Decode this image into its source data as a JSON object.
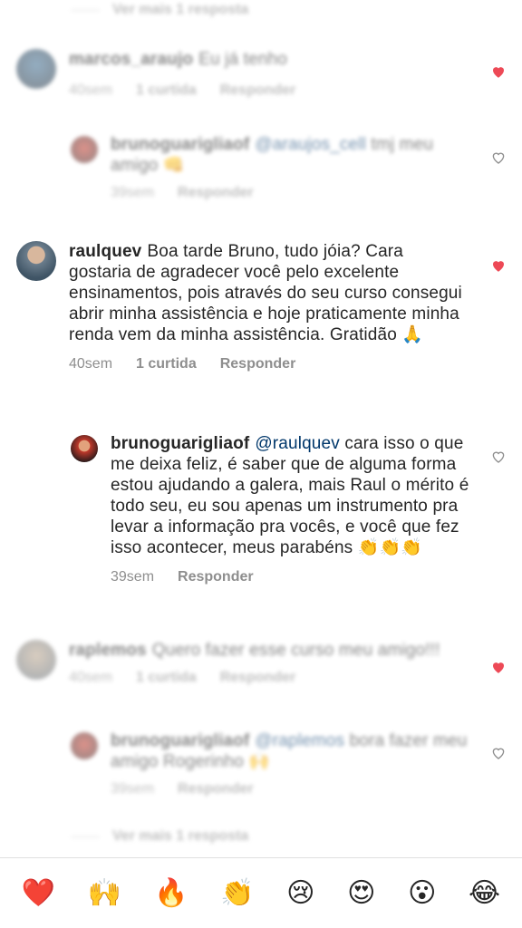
{
  "view_more_top": "Ver mais 1 resposta",
  "view_more_bottom": "Ver mais 1 resposta",
  "comments": {
    "c1": {
      "user": "marcos_araujo",
      "text": "Eu já tenho",
      "time": "40sem",
      "likes": "1 curtida",
      "reply": "Responder"
    },
    "c1r": {
      "user": "brunoguarigliaof",
      "mention": "@araujos_cell",
      "text": "tmj meu amigo 👊",
      "time": "39sem",
      "reply": "Responder"
    },
    "c2": {
      "user": "raulquev",
      "text": "Boa tarde Bruno, tudo jóia? Cara gostaria de agradecer você pelo excelente ensinamentos, pois através do seu curso consegui abrir minha assistência e hoje praticamente minha renda vem da minha assistência. Gratidão 🙏",
      "time": "40sem",
      "likes": "1 curtida",
      "reply": "Responder"
    },
    "c2r": {
      "user": "brunoguarigliaof",
      "mention": "@raulquev",
      "text": "cara isso o que me deixa feliz, é saber que de alguma forma estou ajudando a galera, mais Raul o mérito é todo seu, eu sou apenas um instrumento pra levar a informação pra vocês, e você que fez isso acontecer, meus parabéns 👏👏👏",
      "time": "39sem",
      "reply": "Responder"
    },
    "c3": {
      "user": "raplemos",
      "text": "Quero fazer esse curso meu amigo!!!",
      "time": "40sem",
      "likes": "1 curtida",
      "reply": "Responder"
    },
    "c3r": {
      "user": "brunoguarigliaof",
      "mention": "@raplemos",
      "text": "bora fazer meu amigo Rogerinho 🙌",
      "time": "39sem",
      "reply": "Responder"
    }
  },
  "quick_emojis": [
    "❤️",
    "🙌",
    "🔥",
    "👏",
    "😢",
    "😍",
    "😮",
    "😂"
  ],
  "colors": {
    "liked_heart": "#ed4956",
    "unliked_heart": "#8e8e8e",
    "mention": "#00376b"
  }
}
